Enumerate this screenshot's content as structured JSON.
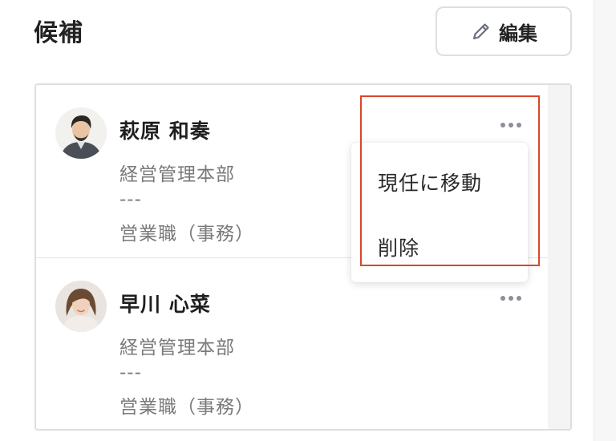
{
  "section": {
    "title": "候補"
  },
  "toolbar": {
    "edit_label": "編集",
    "edit_icon": "pencil-icon"
  },
  "candidates": [
    {
      "name": "萩原 和奏",
      "department": "経営管理本部",
      "separator": "---",
      "job": "営業職（事務）",
      "avatar_icon": "avatar-male-photo"
    },
    {
      "name": "早川 心菜",
      "department": "経営管理本部",
      "separator": "---",
      "job": "営業職（事務）",
      "avatar_icon": "avatar-female-photo"
    }
  ],
  "menu": {
    "more_icon": "more-horizontal-icon",
    "items": [
      {
        "label": "現任に移動"
      },
      {
        "label": "削除"
      }
    ]
  },
  "colors": {
    "highlight": "#d9472b",
    "muted_text": "#7a7a7a",
    "border": "#dedede"
  }
}
